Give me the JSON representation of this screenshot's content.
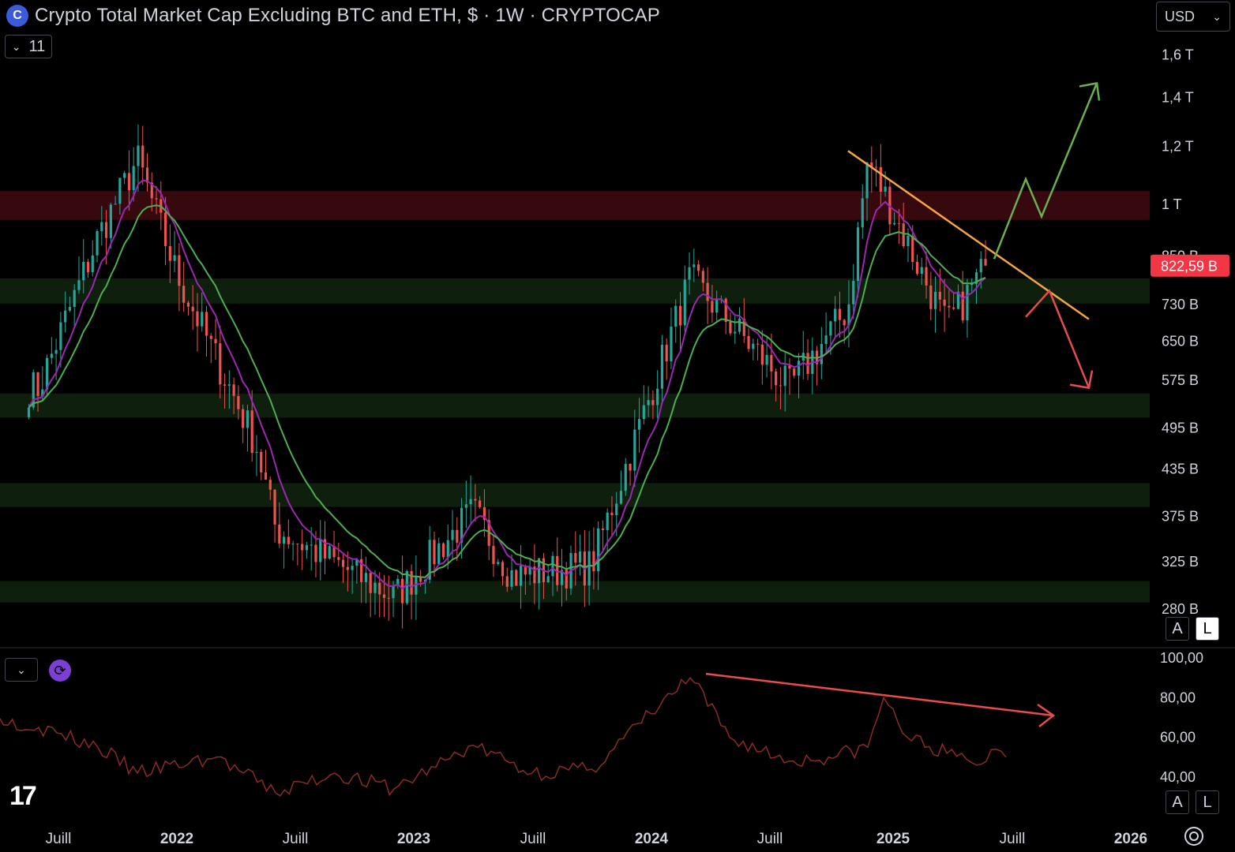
{
  "header": {
    "title": "Crypto Total Market Cap Excluding BTC and ETH, $ · 1W · CRYPTOCAP",
    "indicator_count": "11",
    "currency": "USD"
  },
  "price_pane": {
    "y_ticks": [
      "1,6 T",
      "1,4 T",
      "1,2 T",
      "1 T",
      "850 B",
      "730 B",
      "650 B",
      "575 B",
      "495 B",
      "435 B",
      "375 B",
      "325 B",
      "280 B"
    ],
    "y_tick_values": [
      1600,
      1400,
      1200,
      1000,
      850,
      730,
      650,
      575,
      495,
      435,
      375,
      325,
      280
    ],
    "last_price_label": "822,59 B",
    "last_price": 822.59,
    "scale_buttons": [
      "A",
      "L"
    ]
  },
  "rsi_pane": {
    "y_ticks": [
      "100,00",
      "80,00",
      "60,00",
      "40,00"
    ],
    "y_tick_values": [
      100,
      80,
      60,
      40
    ],
    "scale_buttons": [
      "A",
      "L"
    ]
  },
  "x_axis": {
    "labels": [
      {
        "text": "Juill",
        "bold": false
      },
      {
        "text": "2022",
        "bold": true
      },
      {
        "text": "Juill",
        "bold": false
      },
      {
        "text": "2023",
        "bold": true
      },
      {
        "text": "Juill",
        "bold": false
      },
      {
        "text": "2024",
        "bold": true
      },
      {
        "text": "Juill",
        "bold": false
      },
      {
        "text": "2025",
        "bold": true
      },
      {
        "text": "Juill",
        "bold": false
      },
      {
        "text": "2026",
        "bold": true
      }
    ]
  },
  "chart_data": {
    "type": "candlestick",
    "timeframe": "1W",
    "y_scale": "log",
    "colors": {
      "up": "#26a69a",
      "down": "#ef5350",
      "ema_fast": "#9c27b0",
      "ema_slow": "#4caf50",
      "trendline": "#f7a541",
      "bull_arrow": "#6ab04c",
      "bear_arrow": "#e84c4c",
      "rsi": "#8b2a2a"
    },
    "key_closes": [
      {
        "date": "2021-06",
        "value": 560
      },
      {
        "date": "2021-09",
        "value": 900
      },
      {
        "date": "2021-11",
        "value": 1150
      },
      {
        "date": "2022-01",
        "value": 800
      },
      {
        "date": "2022-05",
        "value": 470
      },
      {
        "date": "2022-06",
        "value": 360
      },
      {
        "date": "2022-12",
        "value": 290
      },
      {
        "date": "2023-04",
        "value": 380
      },
      {
        "date": "2023-06",
        "value": 310
      },
      {
        "date": "2023-10",
        "value": 320
      },
      {
        "date": "2024-03",
        "value": 790
      },
      {
        "date": "2024-08",
        "value": 560
      },
      {
        "date": "2024-11",
        "value": 720
      },
      {
        "date": "2024-12",
        "value": 1150
      },
      {
        "date": "2025-04",
        "value": 680
      },
      {
        "date": "2025-06",
        "value": 822.59
      }
    ],
    "zones": [
      {
        "type": "resistance",
        "from": 950,
        "to": 1040
      },
      {
        "type": "support",
        "from": 730,
        "to": 790
      },
      {
        "type": "support",
        "from": 510,
        "to": 550
      },
      {
        "type": "support",
        "from": 385,
        "to": 415
      },
      {
        "type": "support",
        "from": 285,
        "to": 305
      }
    ],
    "rsi_key": [
      {
        "date": "2024-03",
        "value": 90
      },
      {
        "date": "2024-12",
        "value": 80
      },
      {
        "date": "2025-06",
        "value": 50
      }
    ]
  }
}
